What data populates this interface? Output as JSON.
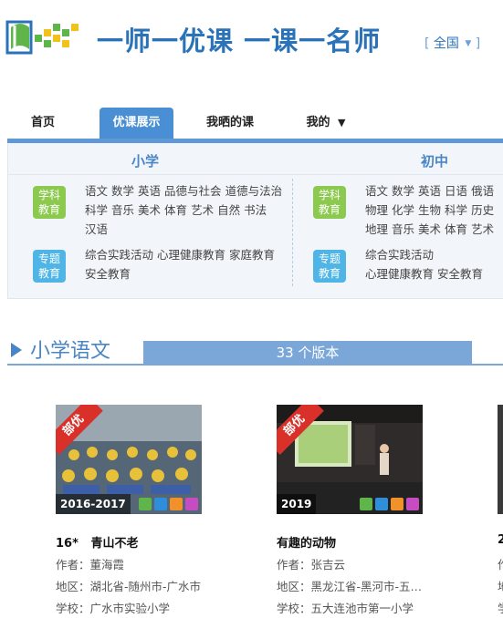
{
  "header": {
    "slogan": "一师一优课 一课一名师",
    "region_open": "[",
    "region": "全国",
    "region_arrow": "▼",
    "region_close": "]"
  },
  "nav": {
    "items": [
      "首页",
      "优课展示",
      "我晒的课",
      "我的"
    ],
    "mine_arrow": "▼",
    "active": "优课展示"
  },
  "panel": {
    "stages": [
      "小学",
      "初中"
    ],
    "primary": {
      "subject_badge": [
        "学科",
        "教育"
      ],
      "subjects": [
        "语文",
        "数学",
        "英语",
        "品德与社会",
        "道德与法治",
        "科学",
        "音乐",
        "美术",
        "体育",
        "艺术",
        "自然",
        "书法",
        "汉语"
      ],
      "topic_badge": [
        "专题",
        "教育"
      ],
      "topics": [
        "综合实践活动",
        "心理健康教育",
        "家庭教育",
        "安全教育"
      ]
    },
    "junior": {
      "subject_badge": [
        "学科",
        "教育"
      ],
      "subjects": [
        "语文",
        "数学",
        "英语",
        "日语",
        "俄语",
        "物理",
        "化学",
        "生物",
        "科学",
        "历史",
        "地理",
        "音乐",
        "美术",
        "体育",
        "艺术"
      ],
      "topic_badge": [
        "专题",
        "教育"
      ],
      "topics": [
        "综合实践活动",
        "心理健康教育",
        "安全教育"
      ]
    }
  },
  "section": {
    "title": "小学语文",
    "count_label": "33 个版本"
  },
  "courses": [
    {
      "ribbon": "部优",
      "year": "2016-2017",
      "lesson_no": "16*",
      "title": "青山不老",
      "author_label": "作者：",
      "author": "董海霞",
      "area_label": "地区：",
      "area": "湖北省-随州市-广水市",
      "school_label": "学校：",
      "school": "广水市实验小学"
    },
    {
      "ribbon": "部优",
      "year": "2019",
      "lesson_no": "",
      "title": "有趣的动物",
      "author_label": "作者：",
      "author": "张吉云",
      "area_label": "地区：",
      "area": "黑龙江省-黑河市-五…",
      "school_label": "学校：",
      "school": "五大连池市第一小学"
    },
    {
      "lesson_no": "2",
      "author_label": "作",
      "area_label": "地",
      "school_label": "学"
    }
  ],
  "colors": {
    "brand_blue": "#2b73b8",
    "nav_active": "#4a8fd4",
    "badge_green": "#8cc94f",
    "badge_blue": "#4fb5e7",
    "ribbon_red": "#d9312a"
  }
}
